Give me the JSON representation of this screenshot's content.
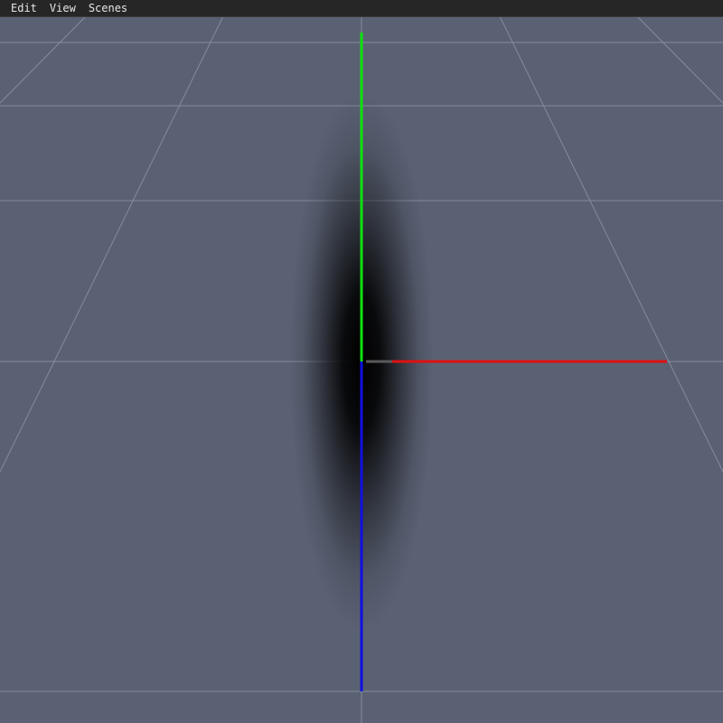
{
  "menubar": {
    "items": [
      {
        "label": "Edit"
      },
      {
        "label": "View"
      },
      {
        "label": "Scenes"
      }
    ]
  },
  "viewport": {
    "background_color": "#5a6173",
    "grid_line_color": "#8c93a4",
    "axes": {
      "x_color": "#e01010",
      "y_color": "#10e010",
      "z_color": "#1010e0"
    },
    "object": "shadow-blob"
  }
}
